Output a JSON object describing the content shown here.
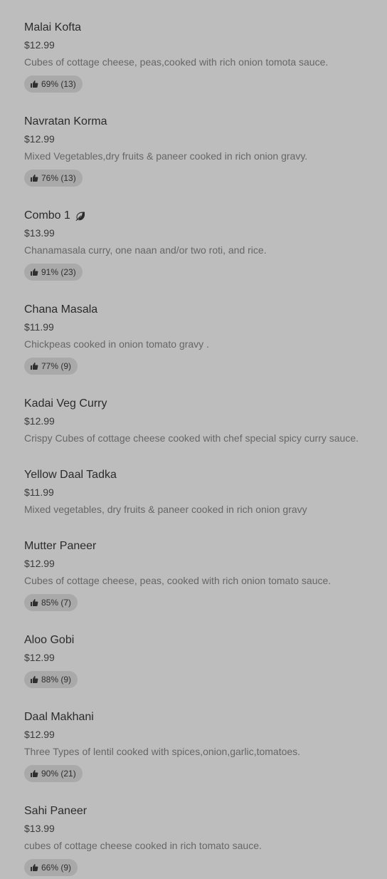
{
  "menu": {
    "items": [
      {
        "name": "Malai Kofta",
        "price": "$12.99",
        "description": "Cubes of cottage cheese, peas,cooked with rich onion tomota sauce.",
        "rating": "69% (13)"
      },
      {
        "name": "Navratan Korma",
        "price": "$12.99",
        "description": "Mixed Vegetables,dry fruits & paneer cooked in rich onion gravy.",
        "rating": "76% (13)"
      },
      {
        "name": "Combo 1",
        "price": "$13.99",
        "description": "Chanamasala curry, one naan and/or two roti, and rice.",
        "rating": "91% (23)",
        "icon": "leaf-icon"
      },
      {
        "name": "Chana Masala",
        "price": "$11.99",
        "description": "Chickpeas cooked in onion tomato gravy .",
        "rating": "77% (9)"
      },
      {
        "name": "Kadai Veg Curry",
        "price": "$12.99",
        "description": "Crispy Cubes of cottage cheese cooked with chef special spicy curry sauce."
      },
      {
        "name": "Yellow Daal Tadka",
        "price": "$11.99",
        "description": "Mixed vegetables, dry fruits & paneer cooked in rich onion gravy"
      },
      {
        "name": "Mutter Paneer",
        "price": "$12.99",
        "description": "Cubes of cottage cheese, peas, cooked with rich onion tomato sauce.",
        "rating": "85% (7)"
      },
      {
        "name": "Aloo Gobi",
        "price": "$12.99",
        "rating": "88% (9)"
      },
      {
        "name": "Daal Makhani",
        "price": "$12.99",
        "description": "Three Types of lentil cooked with spices,onion,garlic,tomatoes.",
        "rating": "90% (21)"
      },
      {
        "name": "Sahi Paneer",
        "price": "$13.99",
        "description": "cubes of cottage cheese cooked in rich tomato sauce.",
        "rating": "66% (9)"
      }
    ]
  },
  "colors": {
    "background": "#bdbdbd",
    "badge": "#a9a9a9",
    "title_text": "#2b2b2b",
    "description_text": "#666666"
  }
}
